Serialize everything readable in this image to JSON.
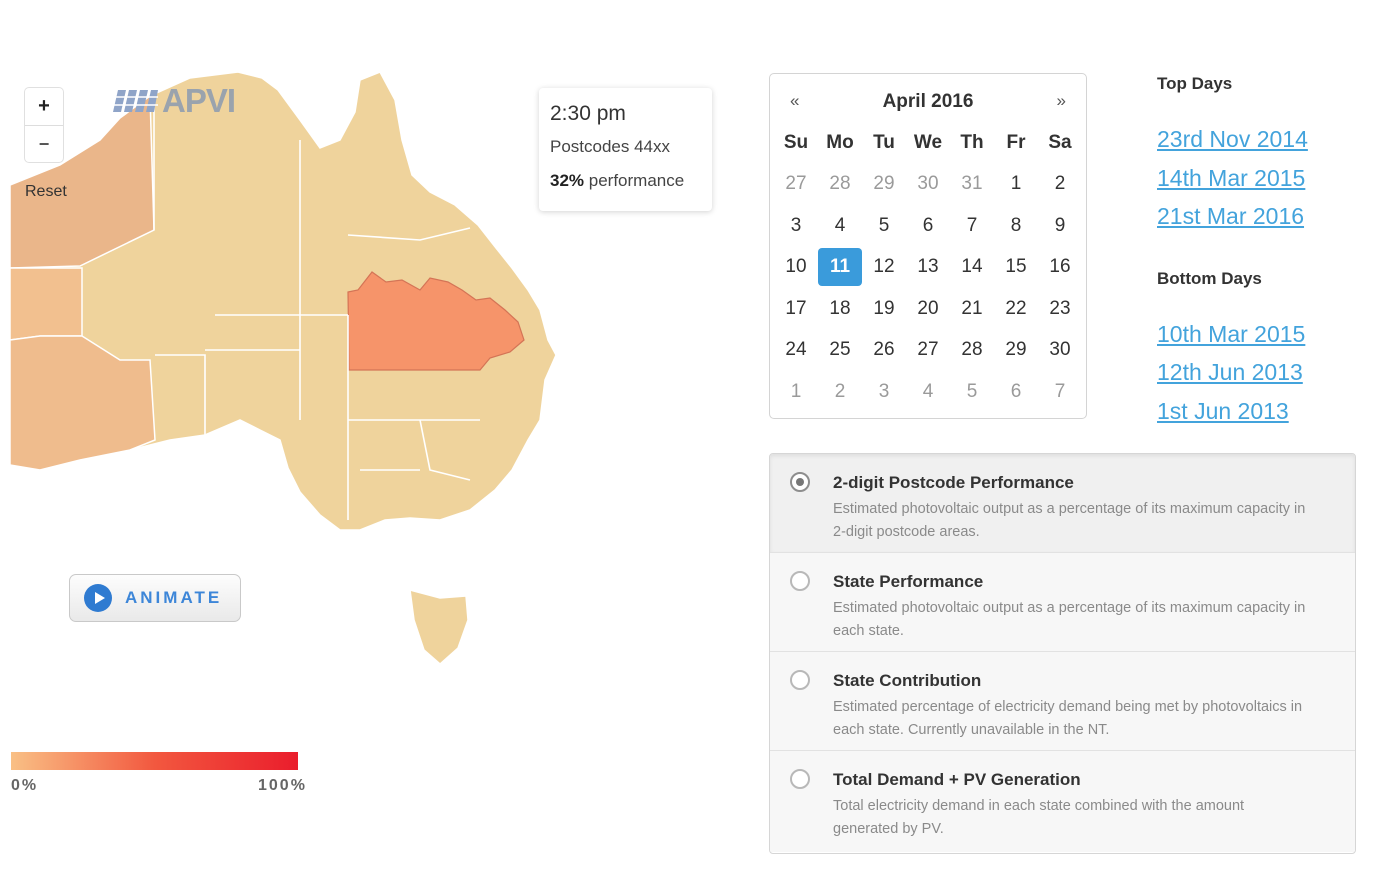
{
  "map": {
    "zoom_in_label": "+",
    "zoom_out_label": "−",
    "reset_label": "Reset",
    "logo_text": "APVI",
    "tooltip": {
      "time": "2:30 pm",
      "postcode": "Postcodes 44xx",
      "performance_value": "32%",
      "performance_label": "performance"
    },
    "animate_label": "ANIMATE",
    "legend": {
      "min_label": "0%",
      "max_label": "100%"
    },
    "colors": {
      "base_fill": "#efd39c",
      "highlight_fill": "#f6946a",
      "western_fill": "#eab68a",
      "border": "#ffffff"
    }
  },
  "calendar": {
    "prev_label": "«",
    "next_label": "»",
    "title": "April 2016",
    "weekdays": [
      "Su",
      "Mo",
      "Tu",
      "We",
      "Th",
      "Fr",
      "Sa"
    ],
    "weeks": [
      [
        "27",
        "28",
        "29",
        "30",
        "31",
        "1",
        "2"
      ],
      [
        "3",
        "4",
        "5",
        "6",
        "7",
        "8",
        "9"
      ],
      [
        "10",
        "11",
        "12",
        "13",
        "14",
        "15",
        "16"
      ],
      [
        "17",
        "18",
        "19",
        "20",
        "21",
        "22",
        "23"
      ],
      [
        "24",
        "25",
        "26",
        "27",
        "28",
        "29",
        "30"
      ],
      [
        "1",
        "2",
        "3",
        "4",
        "5",
        "6",
        "7"
      ]
    ],
    "selected_day": "11",
    "accent_color": "#3a9bdb"
  },
  "top_days": {
    "heading": "Top Days",
    "links": [
      "23rd Nov 2014",
      "14th Mar 2015",
      "21st Mar 2016"
    ]
  },
  "bottom_days": {
    "heading": "Bottom Days",
    "links": [
      "10th Mar 2015",
      "12th Jun 2013",
      "1st Jun 2013"
    ]
  },
  "layers": [
    {
      "title": "2-digit Postcode Performance",
      "description": "Estimated photovoltaic output as a percentage of its maximum capacity in 2-digit postcode areas.",
      "selected": true
    },
    {
      "title": "State Performance",
      "description": "Estimated photovoltaic output as a percentage of its maximum capacity in each state.",
      "selected": false
    },
    {
      "title": "State Contribution",
      "description": "Estimated percentage of electricity demand being met by photovoltaics in each state. Currently unavailable in the NT.",
      "selected": false
    },
    {
      "title": "Total Demand + PV Generation",
      "description": "Total electricity demand in each state combined with the amount generated by PV.",
      "selected": false
    }
  ]
}
